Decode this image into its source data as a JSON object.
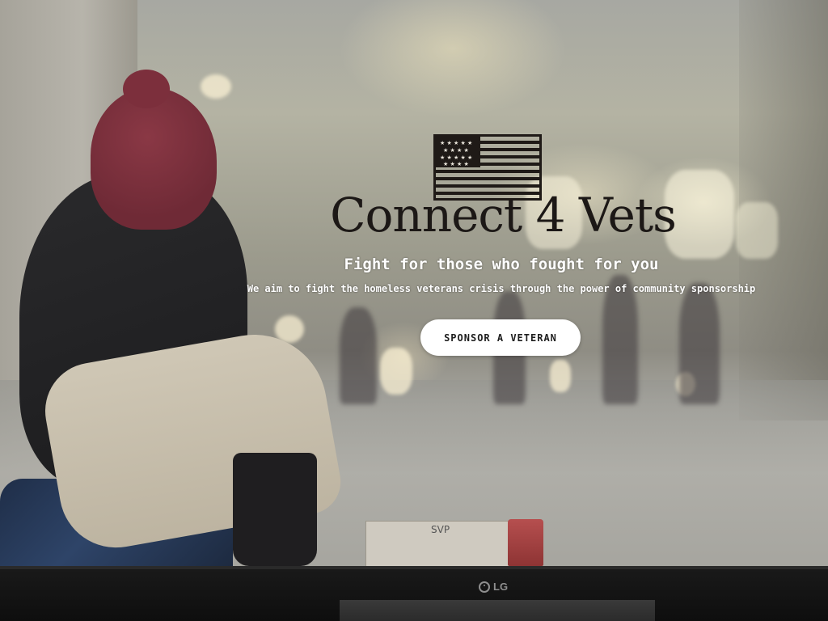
{
  "hero": {
    "brand_title": "Connect 4 Vets",
    "tagline": "Fight for those who fought for you",
    "subtagline": "We aim to fight the homeless veterans crisis through the power of community sponsorship",
    "cta_label": "SPONSOR A VETERAN",
    "logo_icon": "us-flag-icon"
  },
  "photo": {
    "sign_text": "SVP"
  },
  "monitor": {
    "brand": "LG"
  },
  "colors": {
    "brand_text": "#1c1816",
    "cta_background": "#ffffff",
    "headline_text": "#ffffff"
  }
}
